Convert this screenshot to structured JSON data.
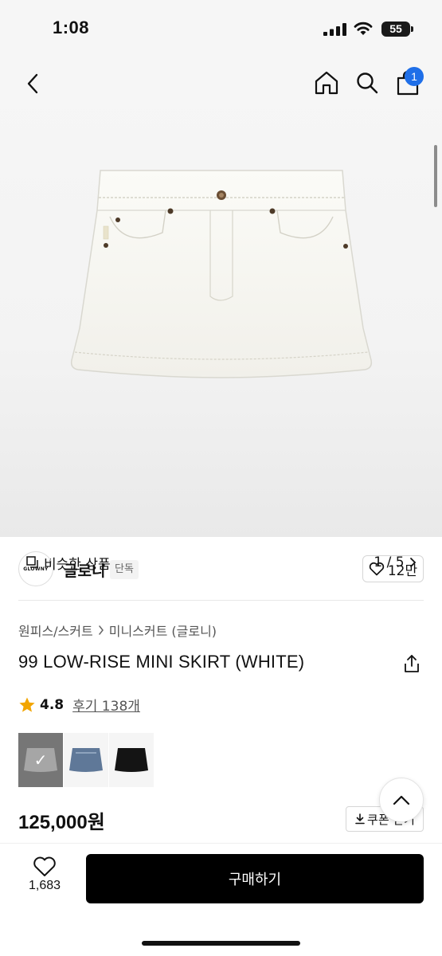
{
  "status_bar": {
    "time": "1:08",
    "battery": "55"
  },
  "header": {
    "icons": [
      "chevron-left-icon",
      "home-icon",
      "search-icon",
      "shopping-bag-icon"
    ],
    "cart_badge": "1"
  },
  "gallery": {
    "similar_label": "비슷한 상품",
    "page_indicator": "1 / 5"
  },
  "brand": {
    "logo_text": "GLOWNY",
    "name": "글로니",
    "tag": "단독",
    "likes": "12만"
  },
  "product": {
    "breadcrumb": [
      "원피스/스커트",
      "미니스커트 (글로니)"
    ],
    "title": "99 LOW-RISE MINI SKIRT (WHITE)",
    "rating": "4.8",
    "reviews": "후기 138개",
    "price": "125,000원",
    "coupon_label": "쿠폰 받기",
    "swatches": [
      "white",
      "blue-denim",
      "black"
    ]
  },
  "bottom_bar": {
    "wish_count": "1,683",
    "buy_label": "구매하기"
  },
  "colors": {
    "accent": "#1f6fe8",
    "buy_button": "#000000",
    "star": "#f2a500"
  }
}
